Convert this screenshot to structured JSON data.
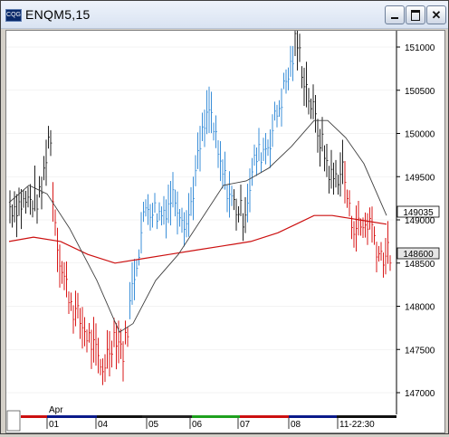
{
  "window": {
    "title": "ENQM5,15",
    "app_icon_text": "CQG"
  },
  "chart": {
    "symbol": "ENQM5",
    "interval": "15",
    "price_axis": {
      "ticks": [
        {
          "label": "151000",
          "value": 151000
        },
        {
          "label": "150500",
          "value": 150500
        },
        {
          "label": "150000",
          "value": 150000
        },
        {
          "label": "149500",
          "value": 149500
        },
        {
          "label": "149000",
          "value": 149000
        },
        {
          "label": "148500",
          "value": 148500
        },
        {
          "label": "148000",
          "value": 148000
        },
        {
          "label": "147500",
          "value": 147500
        },
        {
          "label": "147000",
          "value": 147000
        }
      ],
      "ma_value_label": "149035",
      "last_price_label": "148600"
    },
    "time_axis": {
      "month_label": "Apr",
      "labels": [
        "01",
        "04",
        "05",
        "06",
        "07",
        "08",
        "11-22:30"
      ]
    },
    "colors": {
      "up_bars": "#3b8fd8",
      "down_bars": "#d81818",
      "neutral_bars": "#202020",
      "slow_ma": "#cc1010",
      "fast_ma": "#404040"
    }
  }
}
